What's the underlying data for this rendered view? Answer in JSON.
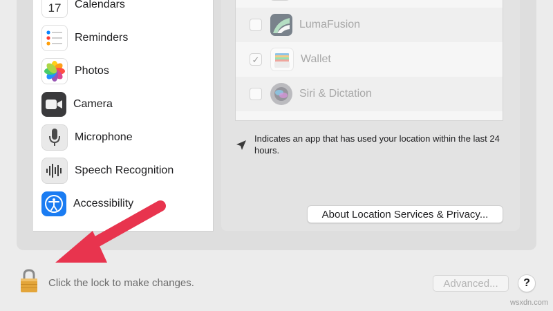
{
  "sidebar": {
    "items": [
      {
        "label": "Calendars",
        "icon": "calendar-icon",
        "icon_text": "17"
      },
      {
        "label": "Reminders",
        "icon": "reminders-icon"
      },
      {
        "label": "Photos",
        "icon": "photos-icon"
      },
      {
        "label": "Camera",
        "icon": "camera-icon"
      },
      {
        "label": "Microphone",
        "icon": "microphone-icon"
      },
      {
        "label": "Speech Recognition",
        "icon": "speech-recognition-icon"
      },
      {
        "label": "Accessibility",
        "icon": "accessibility-icon"
      }
    ]
  },
  "app_list": {
    "rows": [
      {
        "label": "LumaFusion",
        "checked": false,
        "icon": "lumafusion-icon"
      },
      {
        "label": "Wallet",
        "checked": true,
        "check_glyph": "✓",
        "icon": "wallet-icon"
      },
      {
        "label": "Siri & Dictation",
        "checked": false,
        "icon": "siri-icon"
      }
    ]
  },
  "location_note": "Indicates an app that has used your location within the last 24 hours.",
  "about_button": "About Location Services & Privacy...",
  "footer": {
    "lock_text": "Click the lock to make changes.",
    "advanced_button": "Advanced...",
    "help_button": "?"
  },
  "watermark": "wsxdn.com",
  "colors": {
    "annotation_arrow": "#e8344e",
    "lock": "#e3a53a"
  }
}
